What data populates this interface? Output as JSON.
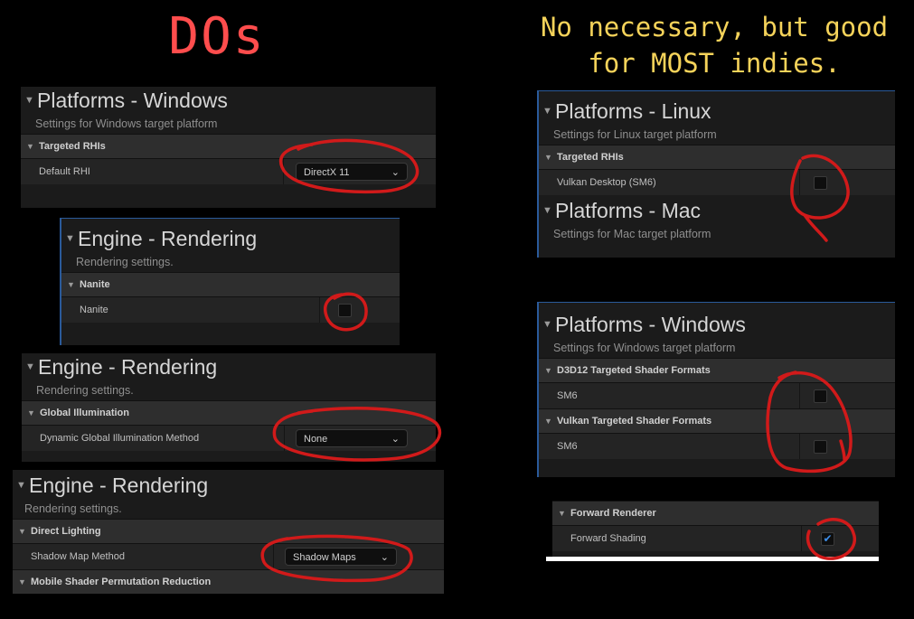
{
  "headings": {
    "dos": "DOs",
    "good_line1": "No necessary, but good",
    "good_line2": "for MOST indies."
  },
  "colors": {
    "dos": "#ff4d4d",
    "good": "#f5d35a",
    "annotation": "#d11a1a",
    "accent_blue": "#2a5a9a"
  },
  "p1": {
    "title": "Platforms - Windows",
    "subtitle": "Settings for Windows target platform",
    "section": "Targeted RHIs",
    "row_label": "Default RHI",
    "value": "DirectX 11"
  },
  "p2": {
    "title": "Engine - Rendering",
    "subtitle": "Rendering settings.",
    "section": "Nanite",
    "row_label": "Nanite",
    "checked": false
  },
  "p3": {
    "title": "Engine - Rendering",
    "subtitle": "Rendering settings.",
    "section": "Global Illumination",
    "row_label": "Dynamic Global Illumination Method",
    "value": "None"
  },
  "p4": {
    "title": "Engine - Rendering",
    "subtitle": "Rendering settings.",
    "section": "Direct Lighting",
    "row_label": "Shadow Map Method",
    "value": "Shadow Maps",
    "section2": "Mobile Shader Permutation Reduction"
  },
  "p5": {
    "title": "Platforms - Linux",
    "subtitle": "Settings for Linux target platform",
    "section": "Targeted RHIs",
    "row_label": "Vulkan Desktop (SM6)",
    "checked": false,
    "title2": "Platforms - Mac",
    "subtitle2": "Settings for Mac target platform"
  },
  "p6": {
    "title": "Platforms - Windows",
    "subtitle": "Settings for Windows target platform",
    "section": "D3D12 Targeted Shader Formats",
    "row_label": "SM6",
    "section2": "Vulkan Targeted Shader Formats",
    "row2_label": "SM6",
    "checked": false,
    "checked2": false
  },
  "p7": {
    "section": "Forward Renderer",
    "row_label": "Forward Shading",
    "checked": true,
    "check_glyph": "✔"
  }
}
